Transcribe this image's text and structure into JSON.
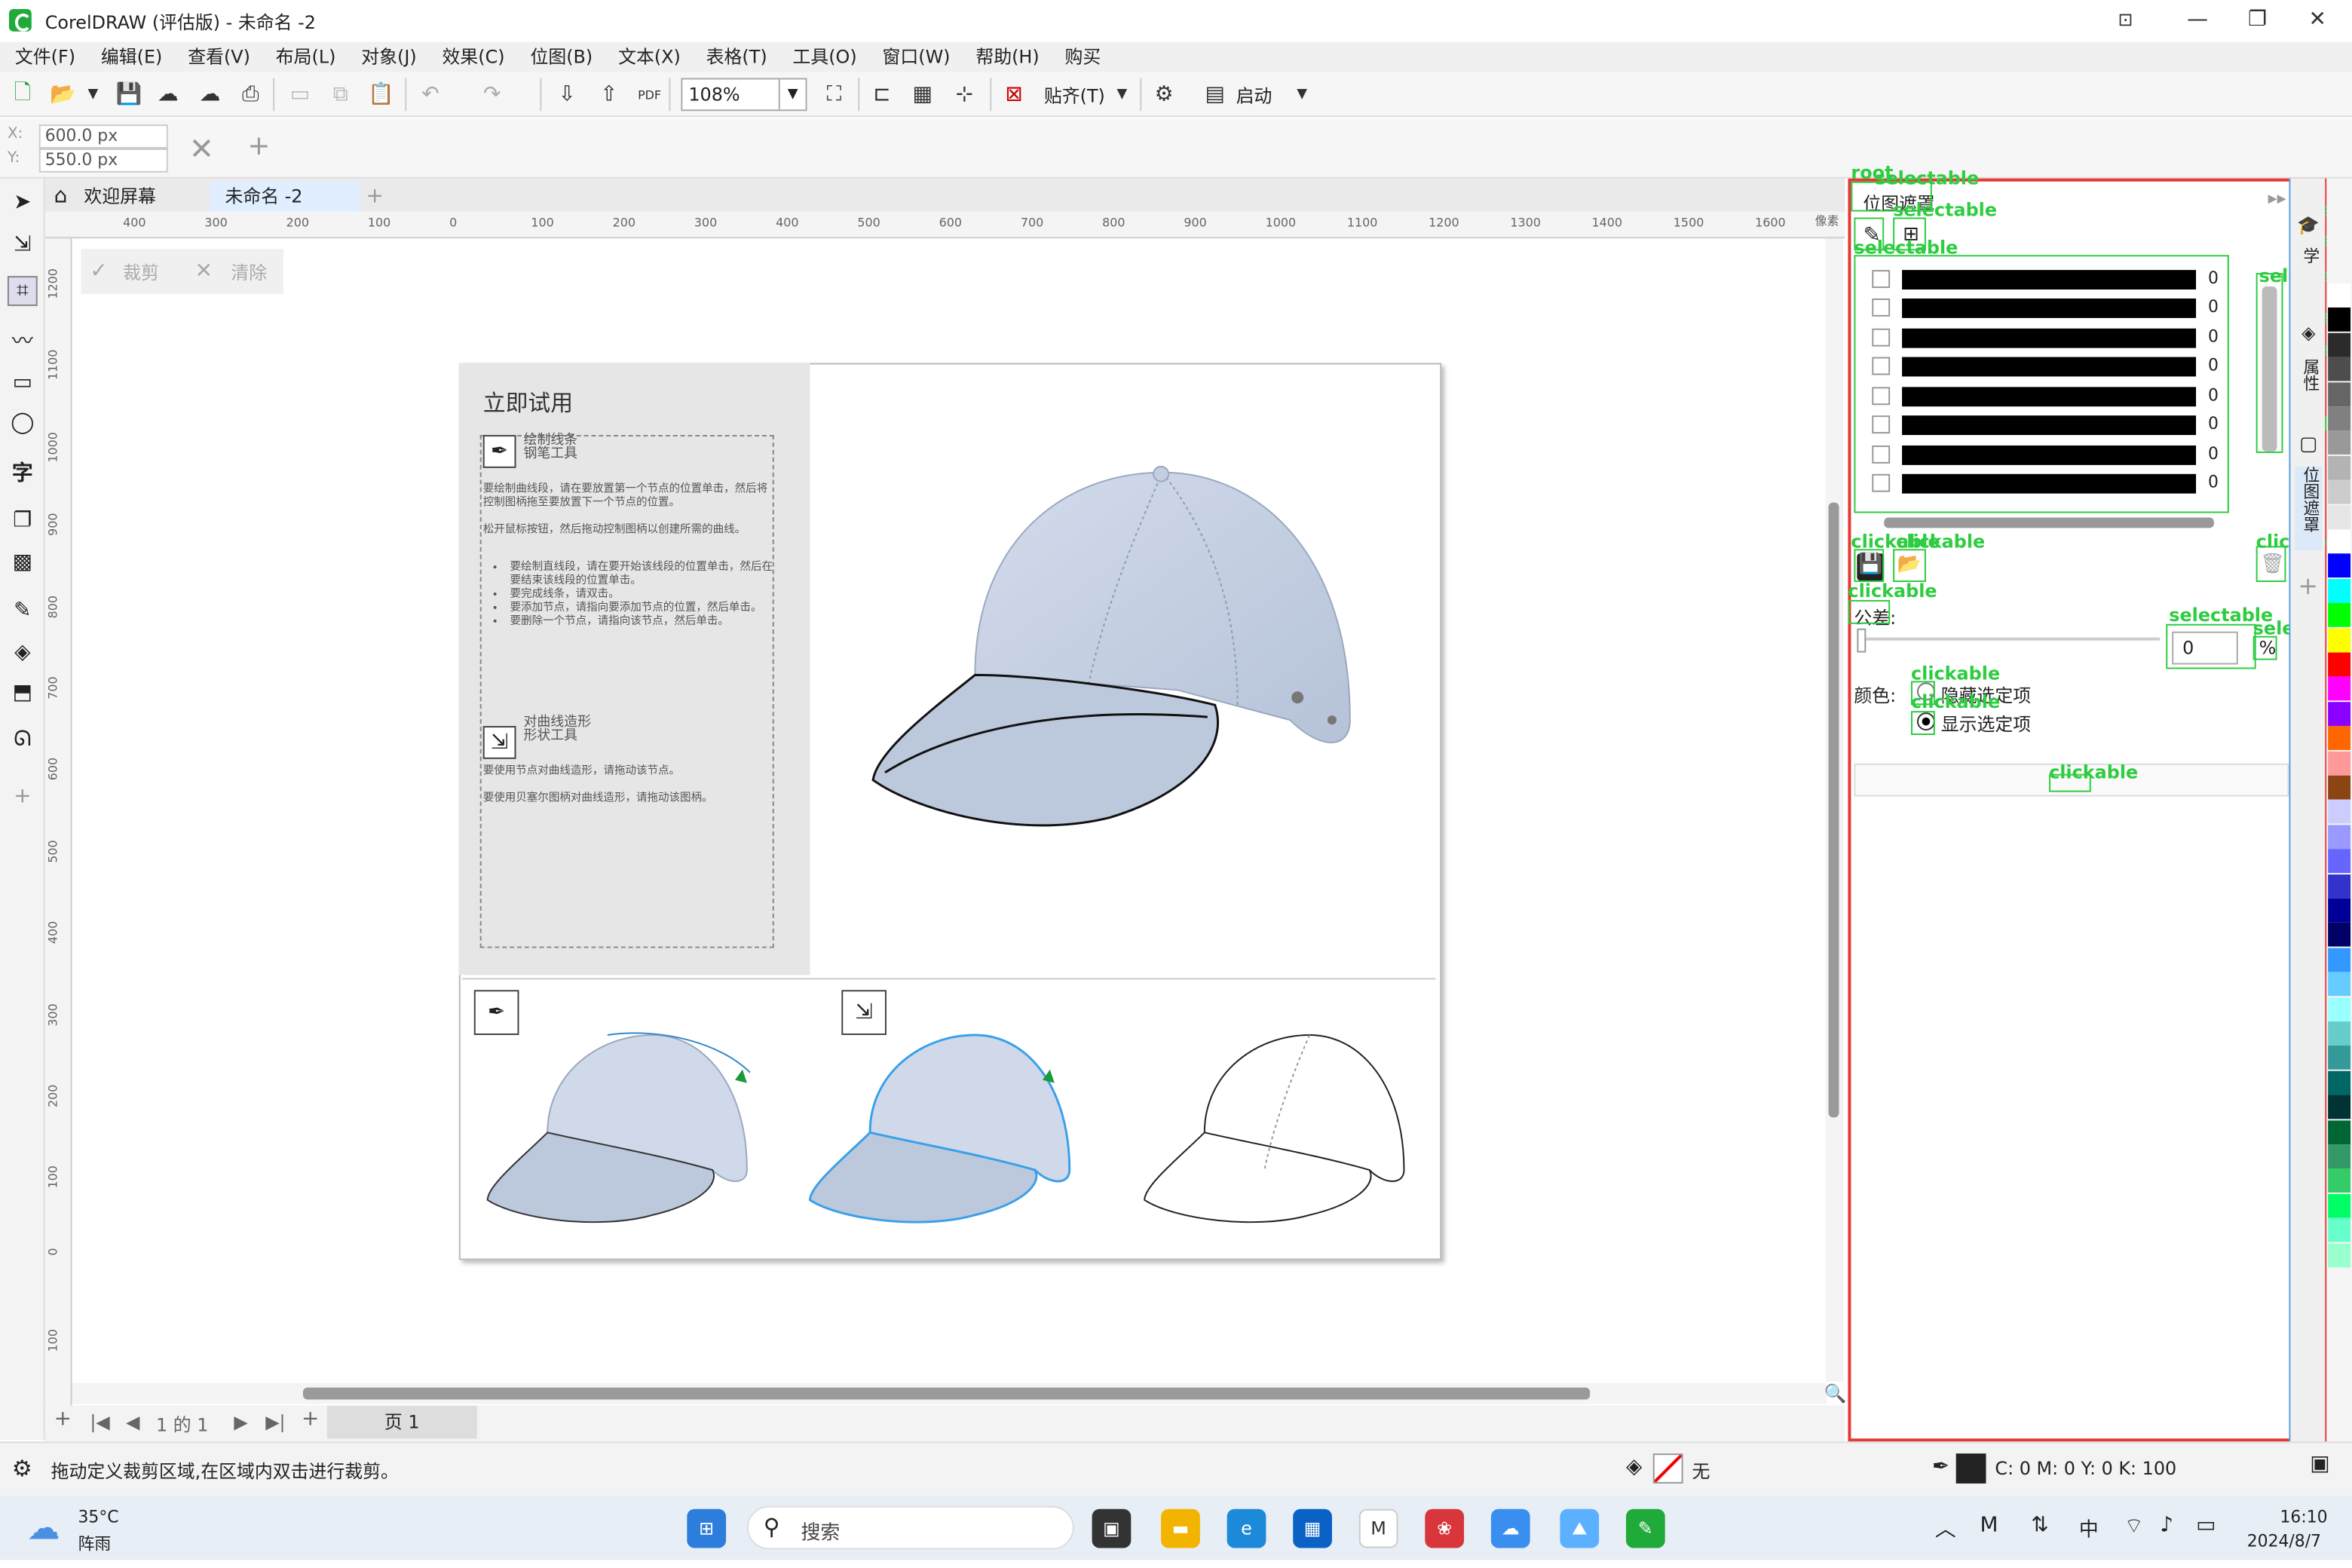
{
  "window": {
    "title": "CorelDRAW (评估版) - 未命名 -2"
  },
  "menu": [
    "文件(F)",
    "编辑(E)",
    "查看(V)",
    "布局(L)",
    "对象(J)",
    "效果(C)",
    "位图(B)",
    "文本(X)",
    "表格(T)",
    "工具(O)",
    "窗口(W)",
    "帮助(H)",
    "购买"
  ],
  "toolbar": {
    "zoom": "108%",
    "snap_label": "贴齐(T)",
    "launch_label": "启动"
  },
  "propbar": {
    "x_label": "X:",
    "y_label": "Y:",
    "x_value": "600.0 px",
    "y_value": "550.0 px"
  },
  "tabs": {
    "welcome": "欢迎屏幕",
    "doc": "未命名 -2"
  },
  "crop": {
    "apply": "裁剪",
    "clear": "清除"
  },
  "ruler": {
    "h": [
      "400",
      "300",
      "200",
      "100",
      "0",
      "100",
      "200",
      "300",
      "400",
      "500",
      "600",
      "700",
      "800",
      "900",
      "1000",
      "1100",
      "1200",
      "1300",
      "1400",
      "1500",
      "1600"
    ],
    "unit": "像素",
    "v": [
      "1200",
      "1100",
      "1000",
      "900",
      "800",
      "700",
      "600",
      "500",
      "400",
      "300",
      "200",
      "100",
      "0",
      "100"
    ]
  },
  "artwork": {
    "title": "立即试用",
    "pen_title": "绘制线条\n钢笔工具",
    "pen_p1": "要绘制曲线段，请在要放置第一个节点的位置单击，然后将控制图柄拖至要放置下一个节点的位置。",
    "pen_p2": "松开鼠标按钮，然后拖动控制图柄以创建所需的曲线。",
    "pen_bullets": [
      "要绘制直线段，请在要开始该线段的位置单击，然后在要结束该线段的位置单击。",
      "要完成线条，请双击。",
      "要添加节点，请指向要添加节点的位置，然后单击。",
      "要删除一个节点，请指向该节点，然后单击。"
    ],
    "shape_title": "对曲线造形\n形状工具",
    "shape_p1": "要使用节点对曲线造形，请拖动该节点。",
    "shape_p2": "要使用贝塞尔图柄对曲线造形，请拖动该图柄。"
  },
  "pagenav": {
    "page_of": "1 的 1",
    "page_tab": "页 1"
  },
  "docker": {
    "title": "位图遮罩",
    "rows": [
      "0",
      "0",
      "0",
      "0",
      "0",
      "0",
      "0",
      "0"
    ],
    "tolerance_label": "公差:",
    "tolerance_value": "0",
    "percent": "%",
    "color_label": "颜色:",
    "hide_option": "隐藏选定项",
    "show_option": "显示选定项",
    "strip_tabs": [
      "学",
      "属性",
      "位图遮罩"
    ]
  },
  "overlays": [
    "root",
    "selectable",
    "selectable",
    "selectable",
    "clickable",
    "clickable",
    "clickable",
    "clickable",
    "selectable",
    "selectable",
    "clickable",
    "clickable",
    "clickable",
    "selectable",
    "selectable",
    "selectable",
    "selectable",
    "selectable",
    "selectable",
    "clickable",
    "clickable"
  ],
  "status": {
    "hint": "拖动定义裁剪区域,在区域内双击进行裁剪。",
    "fill_none": "无",
    "cmyk": "C:  0 M:  0 Y:  0 K:  100"
  },
  "taskbar": {
    "temp": "35°C",
    "weather": "阵雨",
    "search": "搜索",
    "ime": "中",
    "time": "16:10",
    "date": "2024/8/7"
  },
  "palette": [
    "#ffffff",
    "#000000",
    "#2b2b2b",
    "#4d4d4d",
    "#666666",
    "#808080",
    "#999999",
    "#b3b3b3",
    "#cccccc",
    "#e6e6e6",
    "#ffffff",
    "#0000ff",
    "#00ffff",
    "#00ff00",
    "#ffff00",
    "#ff0000",
    "#ff00ff",
    "#8b00ff",
    "#ff6600",
    "#ff9999",
    "#8b4513",
    "#ccccff",
    "#9999ff",
    "#6666ff",
    "#3333cc",
    "#000099",
    "#000066",
    "#3399ff",
    "#66ccff",
    "#99ffff",
    "#66cccc",
    "#339999",
    "#006666",
    "#003333",
    "#006633",
    "#339966",
    "#33cc66",
    "#00ff66",
    "#66ffcc",
    "#99ffcc"
  ]
}
